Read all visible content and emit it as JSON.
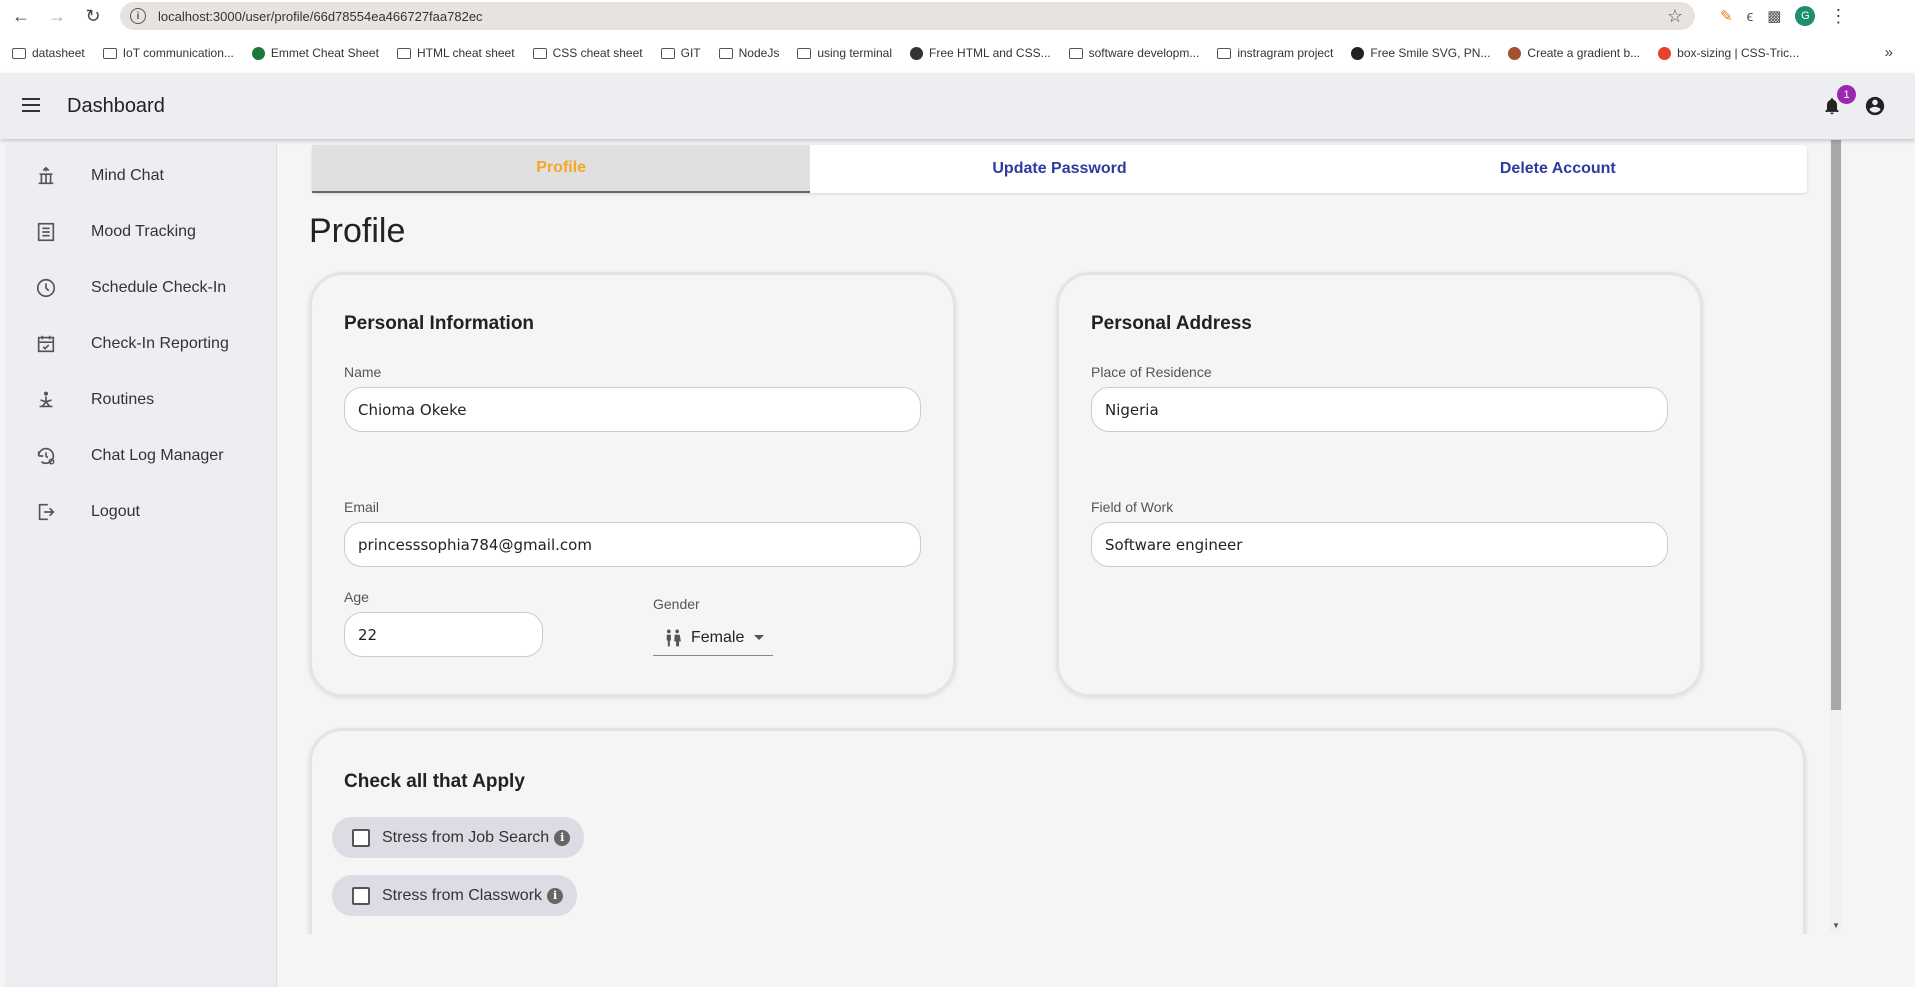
{
  "browser": {
    "url": "localhost:3000/user/profile/66d78554ea466727faa782ec",
    "profile_initial": "G",
    "bookmarks": [
      {
        "label": "datasheet",
        "kind": "folder"
      },
      {
        "label": "IoT communication...",
        "kind": "folder"
      },
      {
        "label": "Emmet Cheat Sheet",
        "kind": "site",
        "color": "#1b7a3a"
      },
      {
        "label": "HTML cheat sheet",
        "kind": "folder"
      },
      {
        "label": "CSS cheat sheet",
        "kind": "folder"
      },
      {
        "label": "GIT",
        "kind": "folder"
      },
      {
        "label": "NodeJs",
        "kind": "folder"
      },
      {
        "label": "using terminal",
        "kind": "folder"
      },
      {
        "label": "Free HTML and CSS...",
        "kind": "site",
        "color": "#333333"
      },
      {
        "label": "software developm...",
        "kind": "folder"
      },
      {
        "label": "instragram project",
        "kind": "folder"
      },
      {
        "label": "Free Smile SVG, PN...",
        "kind": "site",
        "color": "#222222"
      },
      {
        "label": "Create a gradient b...",
        "kind": "site",
        "color": "#a0522d"
      },
      {
        "label": "box-sizing | CSS-Tric...",
        "kind": "site",
        "color": "#e8412c"
      }
    ]
  },
  "appbar": {
    "title": "Dashboard",
    "notification_count": "1"
  },
  "sidebar": {
    "items": [
      {
        "label": "Mind Chat",
        "icon": "chat-network-icon"
      },
      {
        "label": "Mood Tracking",
        "icon": "list-icon"
      },
      {
        "label": "Schedule Check-In",
        "icon": "clock-icon"
      },
      {
        "label": "Check-In Reporting",
        "icon": "calendar-check-icon"
      },
      {
        "label": "Routines",
        "icon": "meditation-icon"
      },
      {
        "label": "Chat Log Manager",
        "icon": "history-settings-icon"
      },
      {
        "label": "Logout",
        "icon": "logout-icon"
      }
    ]
  },
  "tabs": {
    "profile": "Profile",
    "update_password": "Update Password",
    "delete_account": "Delete Account"
  },
  "page": {
    "title": "Profile"
  },
  "personal_info": {
    "heading": "Personal Information",
    "name_label": "Name",
    "name_value": "Chioma Okeke",
    "email_label": "Email",
    "email_value": "princesssophia784@gmail.com",
    "age_label": "Age",
    "age_value": "22",
    "gender_label": "Gender",
    "gender_value": "Female"
  },
  "personal_address": {
    "heading": "Personal Address",
    "residence_label": "Place of Residence",
    "residence_value": "Nigeria",
    "work_label": "Field of Work",
    "work_value": "Software engineer"
  },
  "checklist": {
    "heading": "Check all that Apply",
    "items": [
      {
        "label": "Stress from Job Search",
        "checked": false
      },
      {
        "label": "Stress from Classwork",
        "checked": false
      }
    ]
  },
  "colors": {
    "active_tab": "#f5a623",
    "tab_text": "#2e3b9e",
    "badge": "#9c27b0"
  }
}
